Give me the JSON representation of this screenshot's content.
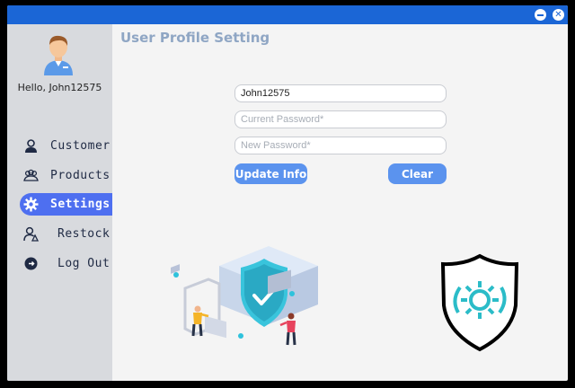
{
  "window": {
    "minimize_icon": "minimize-icon",
    "close_icon": "close-icon",
    "titlebar_color": "#1b66d6"
  },
  "sidebar": {
    "greeting": "Hello, John12575",
    "items": [
      {
        "label": "Customer",
        "icon": "customer-icon",
        "active": false
      },
      {
        "label": "Products",
        "icon": "products-icon",
        "active": false
      },
      {
        "label": "Settings",
        "icon": "gear-icon",
        "active": true
      },
      {
        "label": "Restock",
        "icon": "restock-icon",
        "active": false
      },
      {
        "label": "Log Out",
        "icon": "logout-icon",
        "active": false
      }
    ],
    "accent_color": "#4e6ff0"
  },
  "main": {
    "title": "User Profile Setting",
    "username_value": "John12575",
    "current_password_placeholder": "Current Password*",
    "new_password_placeholder": "New Password*",
    "update_label": "Update Info",
    "clear_label": "Clear",
    "button_color": "#5b93ee"
  }
}
